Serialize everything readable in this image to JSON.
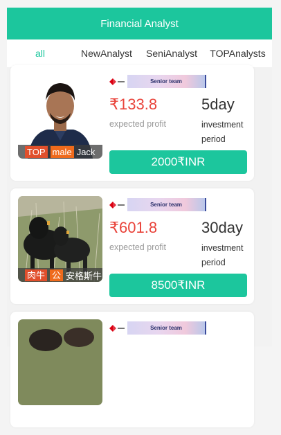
{
  "header": {
    "title": "Financial Analyst"
  },
  "tabs": [
    {
      "label": "all"
    },
    {
      "label": "NewAnalyst"
    },
    {
      "label": "SeniAnalyst"
    },
    {
      "label": "TOPAnalysts"
    }
  ],
  "colors": {
    "accent": "#1cc69d",
    "profit": "#e9433a",
    "chip_red": "#e14f2c",
    "chip_orange": "#ef6a1c"
  },
  "cards": [
    {
      "tags": [
        "TOP",
        "male"
      ],
      "name": "Jack",
      "banner": "Senior team",
      "profit": "₹133.8",
      "profit_label": "expected profit",
      "period": "5day",
      "period_label": "investment period",
      "button": "2000₹INR"
    },
    {
      "tags": [
        "肉牛",
        "公"
      ],
      "name": "安格斯牛",
      "banner": "Senior team",
      "profit": "₹601.8",
      "profit_label": "expected profit",
      "period": "30day",
      "period_label": "investment period",
      "button": "8500₹INR"
    },
    {
      "banner": "Senior team"
    }
  ]
}
